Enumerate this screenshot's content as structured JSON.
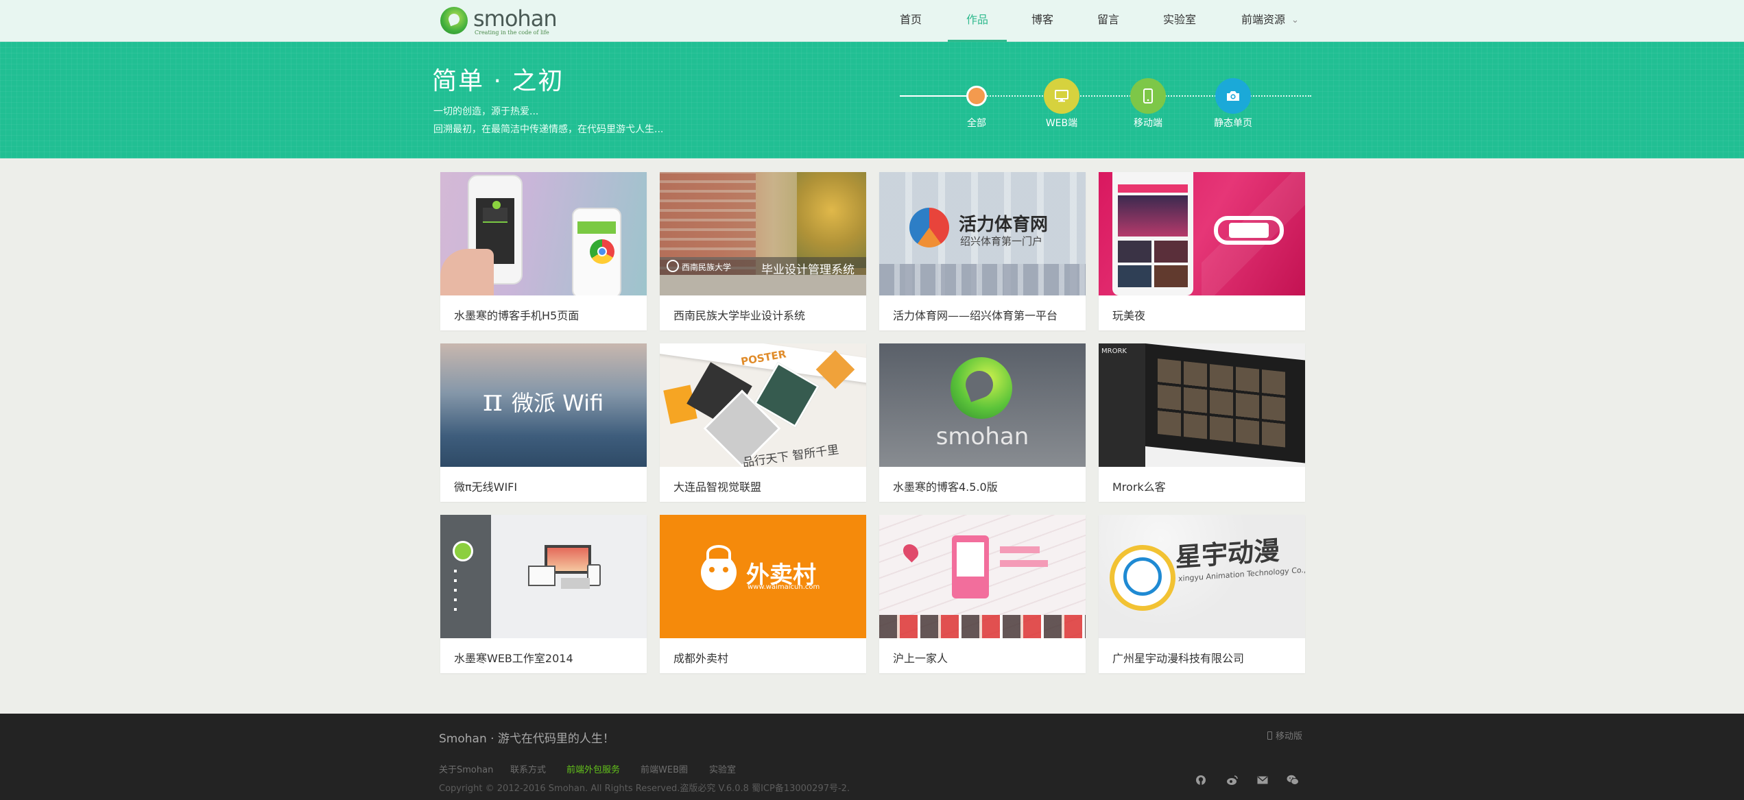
{
  "logo": {
    "text": "smohan",
    "tagline": "Creating in the code of life"
  },
  "nav": {
    "items": [
      {
        "label": "首页",
        "active": false
      },
      {
        "label": "作品",
        "active": true
      },
      {
        "label": "博客",
        "active": false
      },
      {
        "label": "留言",
        "active": false
      },
      {
        "label": "实验室",
        "active": false
      },
      {
        "label": "前端资源",
        "active": false
      }
    ],
    "dropdown_icon": "chevron-down-icon"
  },
  "banner": {
    "title": "简单 · 之初",
    "line1": "一切的创造，源于热爱...",
    "line2": "回溯最初，在最简洁中传递情感，在代码里游弋人生...",
    "steps": [
      {
        "label": "全部",
        "color": "#f39a4e",
        "icon": "dot-icon"
      },
      {
        "label": "WEB端",
        "color": "#d6d23e",
        "icon": "monitor-icon"
      },
      {
        "label": "移动端",
        "color": "#7dc748",
        "icon": "mobile-icon"
      },
      {
        "label": "静态单页",
        "color": "#1ba9d8",
        "icon": "camera-icon"
      }
    ]
  },
  "works": [
    {
      "title": "水墨寒的博客手机H5页面",
      "thumb_text": ""
    },
    {
      "title": "西南民族大学毕业设计系统",
      "thumb_text": "毕业设计管理系统"
    },
    {
      "title": "活力体育网——绍兴体育第一平台",
      "thumb_text": "活力体育网",
      "thumb_sub": "绍兴体育第一门户"
    },
    {
      "title": "玩美夜",
      "thumb_text": ""
    },
    {
      "title": "微π无线WIFI",
      "thumb_text": "微派 Wifi",
      "thumb_symbol": "π"
    },
    {
      "title": "大连品智视觉联盟",
      "thumb_text": "品行天下 智所千里"
    },
    {
      "title": "水墨寒的博客4.5.0版",
      "thumb_text": "smohan"
    },
    {
      "title": "Mrork么客",
      "thumb_text": "MRORK"
    },
    {
      "title": "水墨寒WEB工作室2014",
      "thumb_text": ""
    },
    {
      "title": "成都外卖村",
      "thumb_text": "外卖村",
      "thumb_sub": "www.waimaicun.com"
    },
    {
      "title": "沪上一家人",
      "thumb_text": ""
    },
    {
      "title": "广州星宇动漫科技有限公司",
      "thumb_text": "星宇动漫",
      "thumb_sub": "xingyu Animation Technology Co., L"
    }
  ],
  "footer": {
    "slogan": "Smohan · 游弋在代码里的人生！",
    "mobile": "移动版",
    "links": [
      {
        "label": "关于Smohan",
        "highlight": false
      },
      {
        "label": "联系方式",
        "highlight": false
      },
      {
        "label": "前端外包服务",
        "highlight": true
      },
      {
        "label": "前端WEB圈",
        "highlight": false
      },
      {
        "label": "实验室",
        "highlight": false
      }
    ],
    "copyright": "Copyright © 2012-2016 Smohan. All Rights Reserved.盗版必究 V.6.0.8 蜀ICP备13000297号-2.",
    "social_icons": [
      "github-icon",
      "weibo-icon",
      "mail-icon",
      "wechat-icon"
    ]
  }
}
